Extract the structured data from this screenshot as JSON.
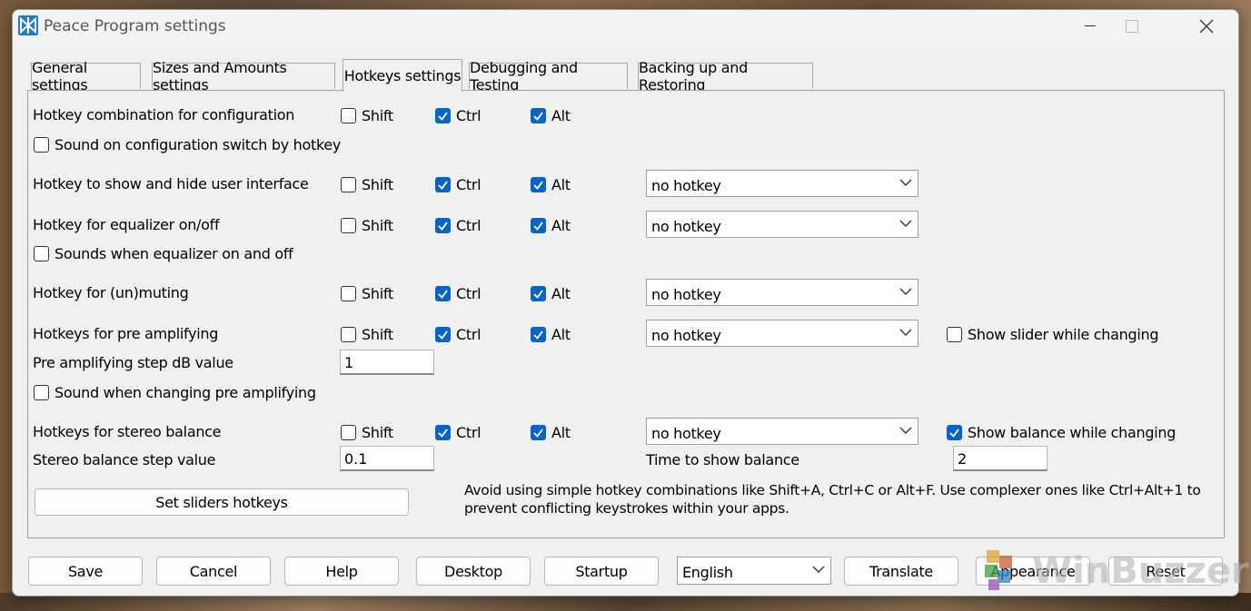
{
  "window": {
    "title": "Peace Program settings"
  },
  "tabs": [
    {
      "label": "General settings"
    },
    {
      "label": "Sizes and Amounts settings"
    },
    {
      "label": "Hotkeys settings"
    },
    {
      "label": "Debugging and Testing"
    },
    {
      "label": "Backing up and Restoring"
    }
  ],
  "modifiers": {
    "shift": "Shift",
    "ctrl": "Ctrl",
    "alt": "Alt"
  },
  "rows": {
    "config": {
      "label": "Hotkey combination for configuration",
      "shift": false,
      "ctrl": true,
      "alt": true
    },
    "config_sound": {
      "label": "Sound on configuration switch by hotkey",
      "checked": false
    },
    "show_hide": {
      "label": "Hotkey to show and hide user interface",
      "shift": false,
      "ctrl": true,
      "alt": true,
      "hotkey": "no hotkey"
    },
    "equalizer": {
      "label": "Hotkey for equalizer on/off",
      "shift": false,
      "ctrl": true,
      "alt": true,
      "hotkey": "no hotkey"
    },
    "equalizer_sound": {
      "label": "Sounds when equalizer on and off",
      "checked": false
    },
    "mute": {
      "label": "Hotkey for (un)muting",
      "shift": false,
      "ctrl": true,
      "alt": true,
      "hotkey": "no hotkey"
    },
    "pre_amp": {
      "label": "Hotkeys for pre amplifying",
      "shift": false,
      "ctrl": true,
      "alt": true,
      "hotkey": "no hotkey",
      "slider_label": "Show slider while changing",
      "slider_checked": false
    },
    "pre_amp_step": {
      "label": "Pre amplifying step dB value",
      "value": "1"
    },
    "pre_amp_sound": {
      "label": "Sound when changing pre amplifying",
      "checked": false
    },
    "balance": {
      "label": "Hotkeys for stereo balance",
      "shift": false,
      "ctrl": true,
      "alt": true,
      "hotkey": "no hotkey",
      "show_label": "Show balance while changing",
      "show_checked": true
    },
    "balance_step": {
      "label": "Stereo balance step value",
      "value": "0.1",
      "time_label": "Time to show balance",
      "time_value": "2"
    }
  },
  "set_sliders_button": "Set sliders hotkeys",
  "info_text": "Avoid using simple hotkey combinations like Shift+A, Ctrl+C or Alt+F. Use complexer ones like Ctrl+Alt+1 to prevent conflicting keystrokes within your apps.",
  "footer": {
    "save": "Save",
    "cancel": "Cancel",
    "help": "Help",
    "desktop": "Desktop",
    "startup": "Startup",
    "language": "English",
    "translate": "Translate",
    "appearance": "Appearance",
    "reset": "Reset"
  },
  "watermark": "WinBuzzer",
  "colors": {
    "accent": "#0a64c8",
    "window_bg": "#f0f0f0"
  }
}
